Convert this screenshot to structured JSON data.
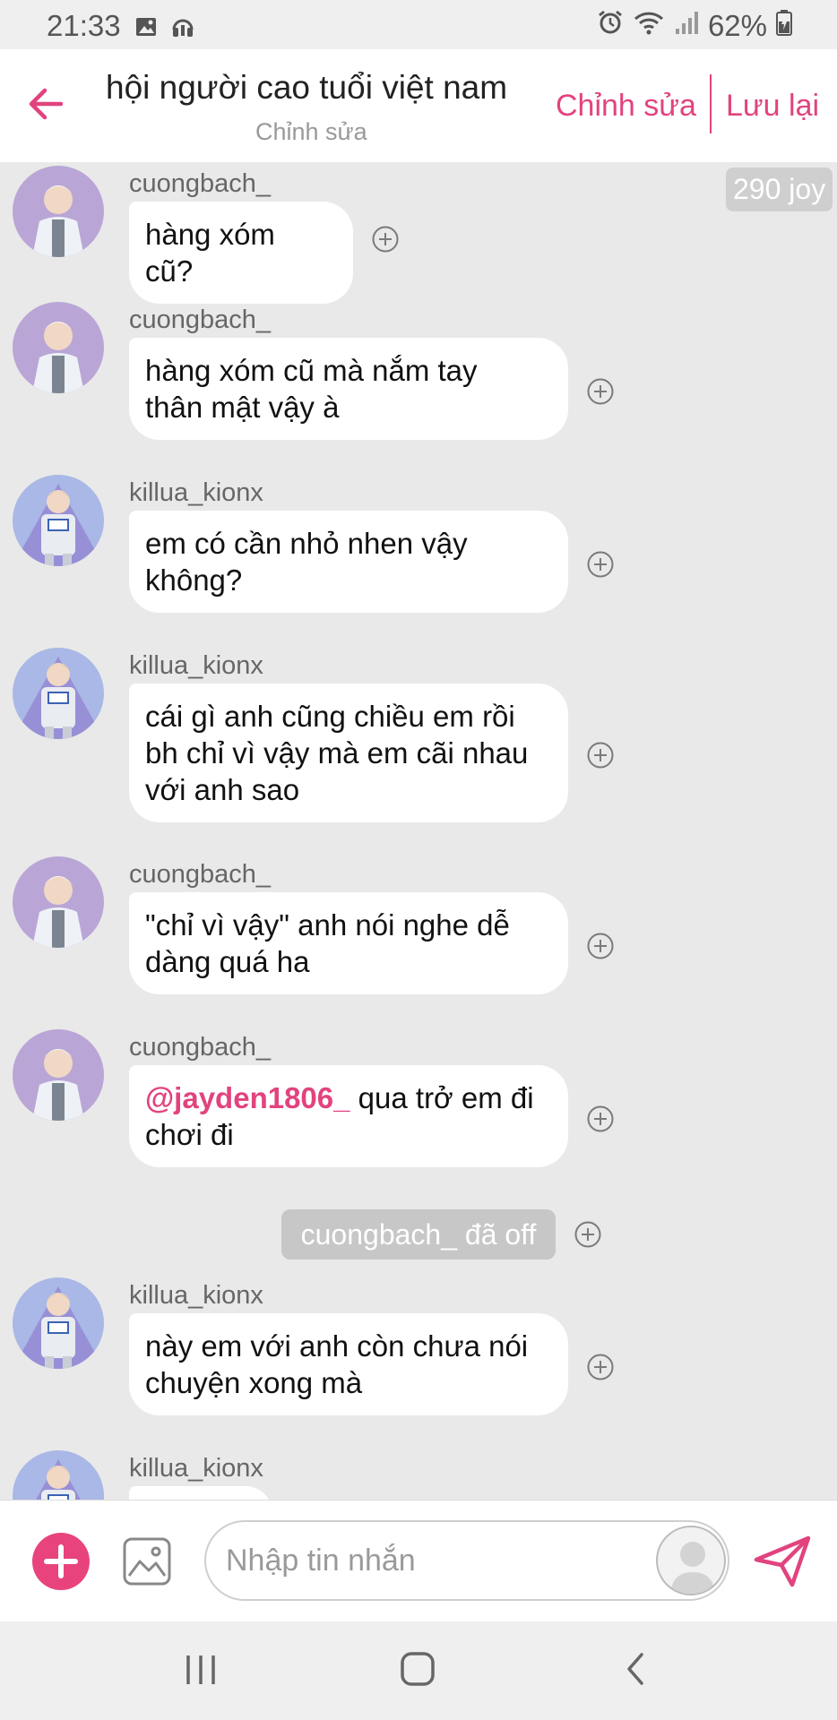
{
  "status_bar": {
    "time": "21:33",
    "battery": "62%",
    "left_icons": [
      "image-icon",
      "headphones-icon"
    ],
    "right_icons": [
      "alarm-icon",
      "wifi-icon",
      "signal-icon",
      "battery-icon"
    ]
  },
  "header": {
    "title": "hội người cao tuổi việt nam",
    "subtitle": "Chỉnh sửa",
    "edit_label": "Chỉnh sửa",
    "save_label": "Lưu lại",
    "accent_color": "#e2437f"
  },
  "joy_badge": "290 joy",
  "messages": [
    {
      "user": "cuongbach_",
      "text": "hàng xóm cũ?"
    },
    {
      "user": "cuongbach_",
      "text": "hàng xóm cũ mà nắm tay thân mật vậy à"
    },
    {
      "user": "killua_kionx",
      "text": "em có cần nhỏ nhen vậy không?"
    },
    {
      "user": "killua_kionx",
      "text": "cái gì anh cũng chiều em rồi bh chỉ vì vậy mà em cãi nhau với anh sao"
    },
    {
      "user": "cuongbach_",
      "text": "\"chỉ vì vậy\" anh nói nghe dễ dàng quá ha"
    },
    {
      "user": "cuongbach_",
      "mention": "@jayden1806_",
      "text": " qua trở em đi chơi đi"
    },
    {
      "user": "killua_kionx",
      "text": "này em với anh còn chưa nói chuyện xong mà"
    },
    {
      "user": "killua_kionx",
      "text": ""
    }
  ],
  "system_message": "cuongbach_ đã off",
  "composer": {
    "placeholder": "Nhập tin nhắn",
    "add_color": "#e8437d"
  }
}
